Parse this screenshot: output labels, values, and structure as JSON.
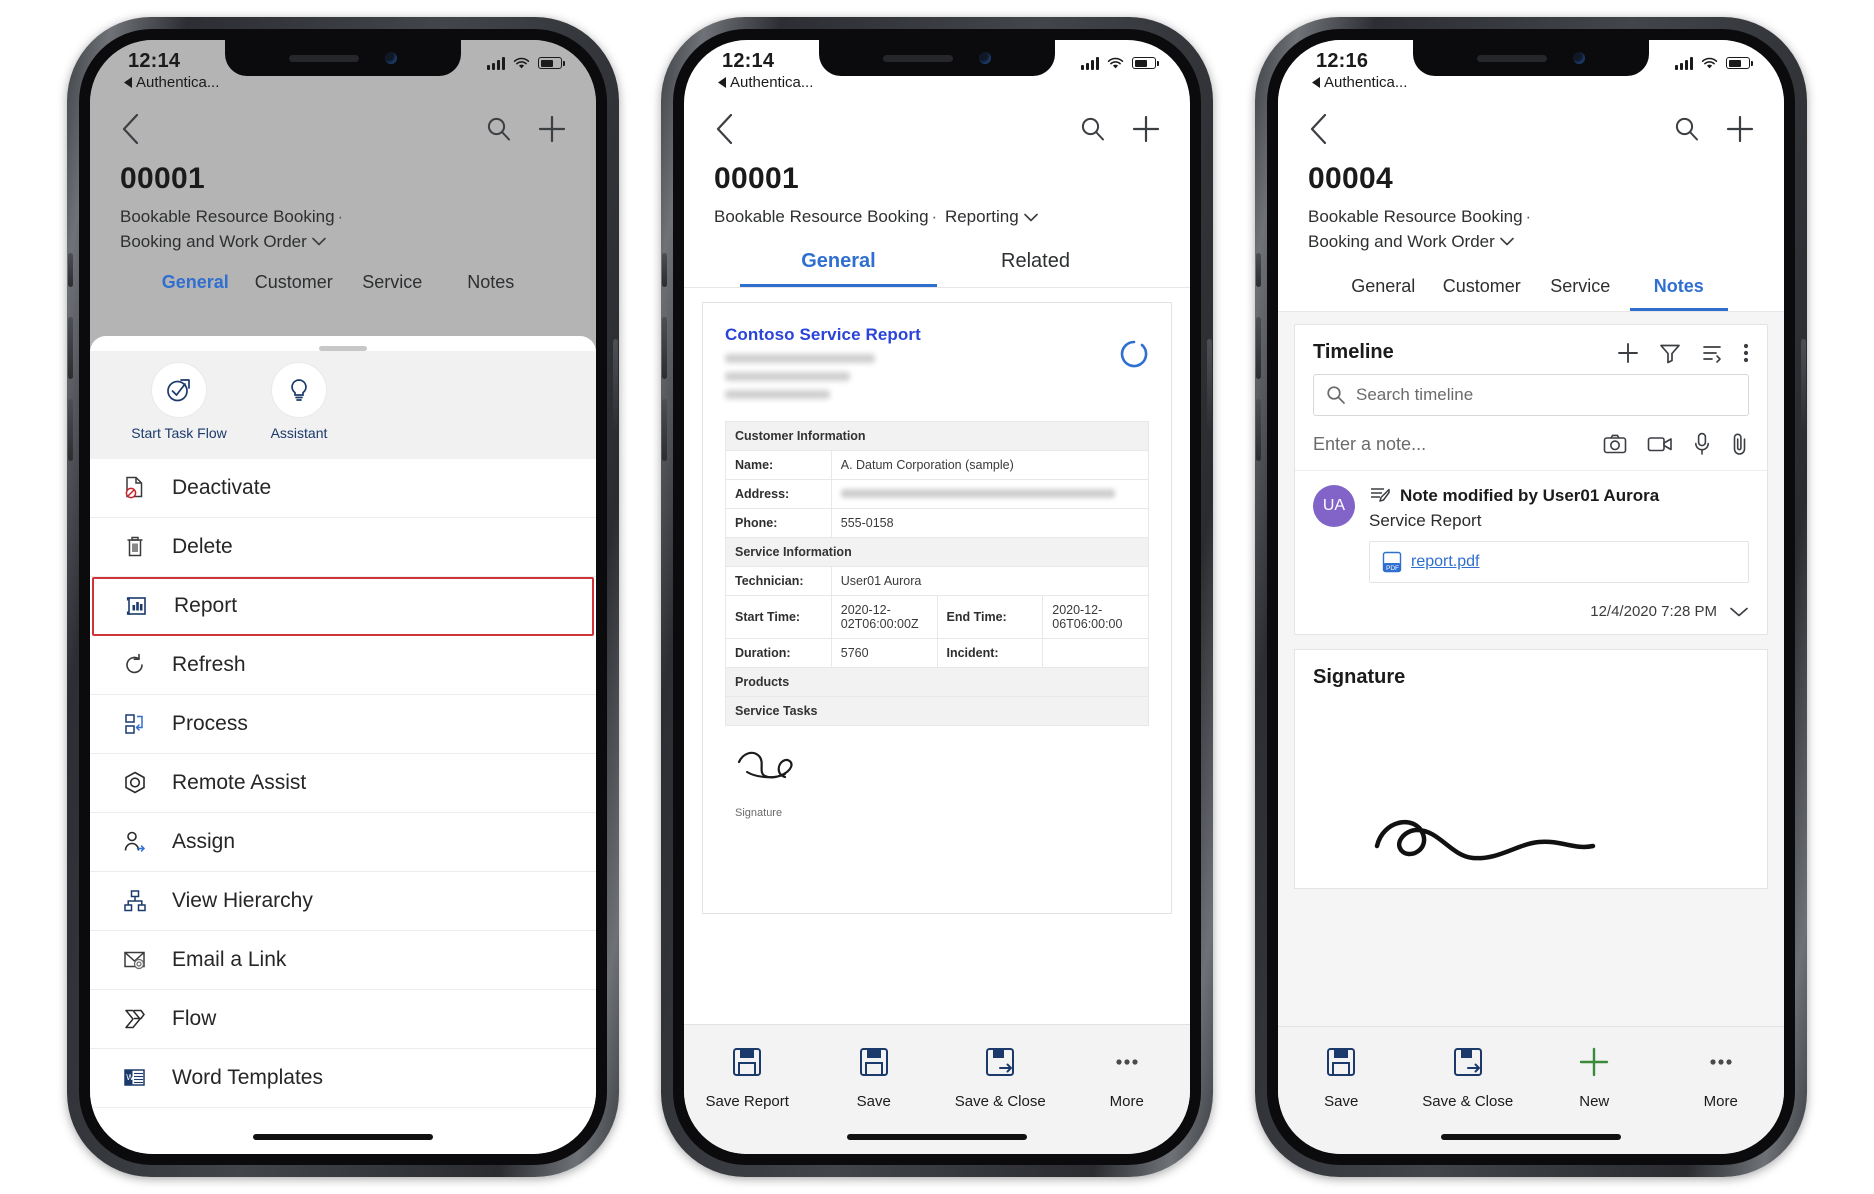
{
  "phones": [
    {
      "status": {
        "time": "12:14",
        "back_app": "Authentica..."
      },
      "record_id": "00001",
      "entity": "Bookable Resource Booking",
      "form_name": "Booking and Work Order",
      "tabs": [
        "General",
        "Customer",
        "Service",
        "Notes"
      ],
      "active_tab": "General",
      "quick_actions": [
        {
          "label": "Start Task Flow",
          "icon": "task-flow-icon"
        },
        {
          "label": "Assistant",
          "icon": "lightbulb-icon"
        }
      ],
      "menu_items": [
        {
          "label": "Deactivate",
          "icon": "deactivate-icon",
          "highlighted": false
        },
        {
          "label": "Delete",
          "icon": "trash-icon",
          "highlighted": false
        },
        {
          "label": "Report",
          "icon": "report-icon",
          "highlighted": true
        },
        {
          "label": "Refresh",
          "icon": "refresh-icon",
          "highlighted": false
        },
        {
          "label": "Process",
          "icon": "process-icon",
          "highlighted": false
        },
        {
          "label": "Remote Assist",
          "icon": "remote-assist-icon",
          "highlighted": false
        },
        {
          "label": "Assign",
          "icon": "assign-person-icon",
          "highlighted": false
        },
        {
          "label": "View Hierarchy",
          "icon": "hierarchy-icon",
          "highlighted": false
        },
        {
          "label": "Email a Link",
          "icon": "email-link-icon",
          "highlighted": false
        },
        {
          "label": "Flow",
          "icon": "flow-icon",
          "highlighted": false
        },
        {
          "label": "Word Templates",
          "icon": "word-icon",
          "highlighted": false
        }
      ],
      "highlight_color": "#d13438"
    },
    {
      "status": {
        "time": "12:14",
        "back_app": "Authentica..."
      },
      "record_id": "00001",
      "entity": "Bookable Resource Booking",
      "form_name": "Reporting",
      "tabs": [
        "General",
        "Related"
      ],
      "active_tab": "General",
      "report": {
        "title": "Contoso Service Report",
        "header_lines_redacted": 3,
        "sections": [
          {
            "type": "section",
            "label": "Customer Information"
          },
          {
            "type": "row",
            "key": "Name:",
            "value": "A. Datum Corporation (sample)"
          },
          {
            "type": "row",
            "key": "Address:",
            "value": "",
            "redacted": true
          },
          {
            "type": "row",
            "key": "Phone:",
            "value": "555-0158"
          },
          {
            "type": "section",
            "label": "Service Information"
          },
          {
            "type": "row",
            "key": "Technician:",
            "value": "User01 Aurora"
          },
          {
            "type": "row2",
            "key": "Start Time:",
            "value": "2020-12-02T06:00:00Z",
            "key2": "End Time:",
            "value2": "2020-12-06T06:00:00"
          },
          {
            "type": "row2",
            "key": "Duration:",
            "value": "5760",
            "key2": "Incident:",
            "value2": ""
          },
          {
            "type": "section",
            "label": "Products"
          },
          {
            "type": "section",
            "label": "Service Tasks"
          }
        ],
        "signature_caption": "Signature"
      },
      "commands": [
        {
          "label": "Save Report",
          "icon": "save-report-icon"
        },
        {
          "label": "Save",
          "icon": "save-icon"
        },
        {
          "label": "Save & Close",
          "icon": "save-close-icon"
        },
        {
          "label": "More",
          "icon": "ellipsis-icon"
        }
      ]
    },
    {
      "status": {
        "time": "12:16",
        "back_app": "Authentica..."
      },
      "record_id": "00004",
      "entity": "Bookable Resource Booking",
      "form_name": "Booking and Work Order",
      "tabs": [
        "General",
        "Customer",
        "Service",
        "Notes"
      ],
      "active_tab": "Notes",
      "timeline": {
        "title": "Timeline",
        "actions": [
          "add-icon",
          "filter-icon",
          "sort-icon",
          "more-vert-icon"
        ],
        "search_placeholder": "Search timeline",
        "note_placeholder": "Enter a note...",
        "note_action_icons": [
          "camera-icon",
          "video-icon",
          "microphone-icon",
          "attachment-icon"
        ],
        "entries": [
          {
            "initials": "UA",
            "title": "Note modified by User01 Aurora",
            "subtitle": "Service Report",
            "attachment": "report.pdf",
            "timestamp": "12/4/2020 7:28 PM"
          }
        ]
      },
      "signature_card": {
        "title": "Signature"
      },
      "commands": [
        {
          "label": "Save",
          "icon": "save-icon"
        },
        {
          "label": "Save & Close",
          "icon": "save-close-icon"
        },
        {
          "label": "New",
          "icon": "plus-icon"
        },
        {
          "label": "More",
          "icon": "ellipsis-icon"
        }
      ],
      "accent_color": "#2f6fd0",
      "avatar_color": "#8264c8"
    }
  ]
}
